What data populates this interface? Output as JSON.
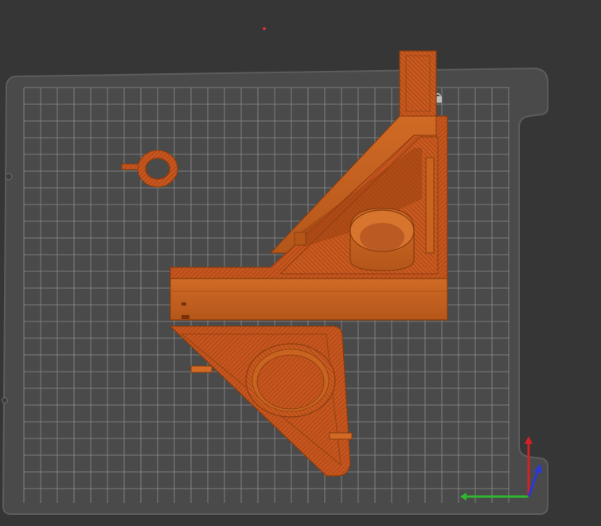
{
  "app": {
    "view": "3d-slicer-plater-viewport",
    "colors": {
      "background": "#363636",
      "bed": "#4a4a4a",
      "bed_edge": "#5a5a5a",
      "grid": "#8d8d8d",
      "filament": "#c8641f",
      "filament_dark": "#8a3d0e",
      "filament_hatch": "#b0451a",
      "axis_x": "#d32222",
      "axis_y": "#2fb82f",
      "axis_z": "#2c38d8"
    },
    "icons": {
      "bed_label": "lock-icon",
      "origin_marker": "red-dot-icon",
      "gizmo": "xyz-axis-gizmo-icon"
    },
    "objects": [
      {
        "name": "corner-bracket-part"
      },
      {
        "name": "triangle-gusset-part"
      },
      {
        "name": "ring-clip-part"
      }
    ]
  }
}
